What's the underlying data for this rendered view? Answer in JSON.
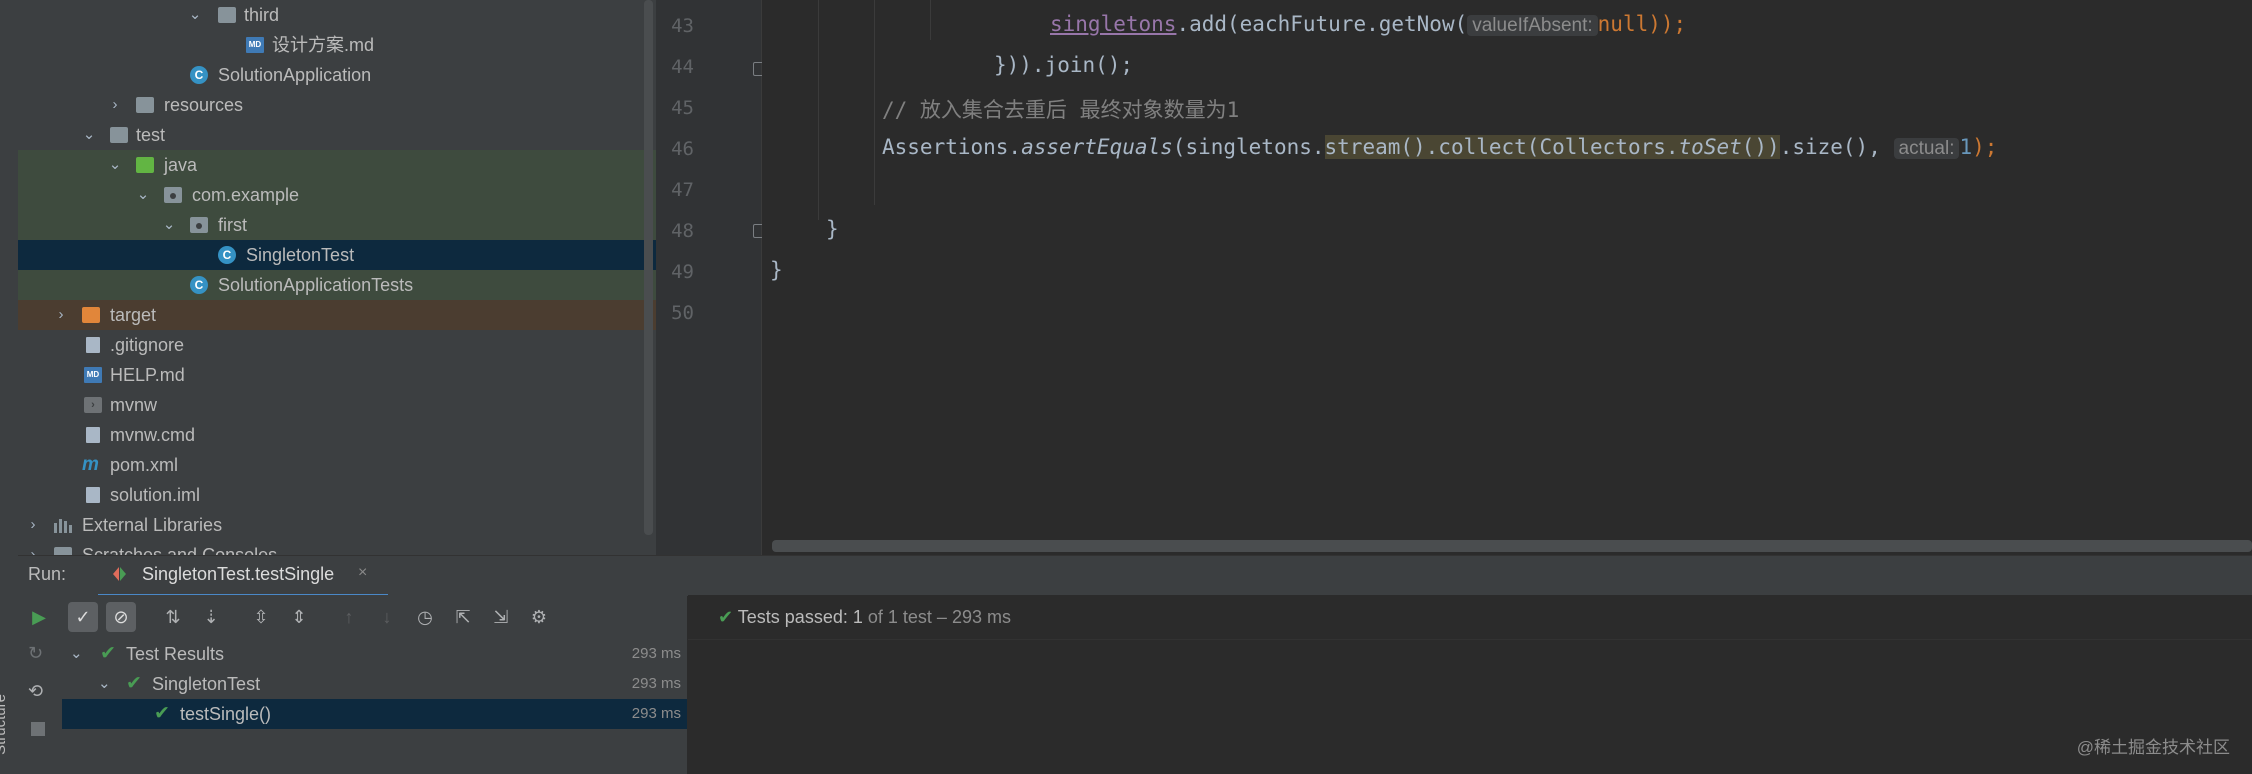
{
  "project_tree": {
    "items": [
      {
        "label": "third",
        "icon": "folder-icon"
      },
      {
        "label": "设计方案.md",
        "icon": "markdown-file-icon"
      },
      {
        "label": "SolutionApplication",
        "icon": "spring-class-icon"
      },
      {
        "label": "resources",
        "icon": "resources-folder-icon"
      },
      {
        "label": "test",
        "icon": "folder-icon"
      },
      {
        "label": "java",
        "icon": "test-source-folder-icon"
      },
      {
        "label": "com.example",
        "icon": "package-icon"
      },
      {
        "label": "first",
        "icon": "package-icon"
      },
      {
        "label": "SingletonTest",
        "icon": "test-class-icon"
      },
      {
        "label": "SolutionApplicationTests",
        "icon": "spring-class-icon"
      },
      {
        "label": "target",
        "icon": "excluded-folder-icon"
      },
      {
        "label": ".gitignore",
        "icon": "gitignore-file-icon"
      },
      {
        "label": "HELP.md",
        "icon": "markdown-file-icon"
      },
      {
        "label": "mvnw",
        "icon": "terminal-file-icon"
      },
      {
        "label": "mvnw.cmd",
        "icon": "text-file-icon"
      },
      {
        "label": "pom.xml",
        "icon": "maven-icon"
      },
      {
        "label": "solution.iml",
        "icon": "module-file-icon"
      },
      {
        "label": "External Libraries",
        "icon": "libraries-icon"
      },
      {
        "label": "Scratches and Consoles",
        "icon": "scratches-icon"
      }
    ]
  },
  "editor": {
    "line_numbers": [
      "43",
      "44",
      "45",
      "46",
      "47",
      "48",
      "49",
      "50"
    ],
    "line43": {
      "field": "singletons",
      "call": ".add(eachFuture.getNow(",
      "hint": "valueIfAbsent:",
      "kw": "null",
      "close": "));"
    },
    "line44": {
      "text": "})).join();"
    },
    "line45": {
      "comment": "// 放入集合去重后 最终对象数量为1"
    },
    "line46": {
      "cls": "Assertions.",
      "method": "assertEquals",
      "arg": "(singletons.",
      "hl": "stream().collect(Collectors.",
      "hl_method": "toSet",
      "hl_end": "())",
      "rest": ".size(),",
      "hint": "actual:",
      "num": "1",
      "close": ");"
    },
    "line48": {
      "text": "}"
    },
    "line49": {
      "text": "}"
    }
  },
  "run": {
    "label": "Run:",
    "tab_label": "SingletonTest.testSingle",
    "tab_close": "×",
    "toolbar": [
      {
        "name": "rerun-icon",
        "glyph": "▶"
      },
      {
        "name": "show-passed-icon",
        "glyph": "✓"
      },
      {
        "name": "show-ignored-icon",
        "glyph": "⊘"
      },
      {
        "name": "sort-alphabetically-icon",
        "glyph": "⇅"
      },
      {
        "name": "sort-by-duration-icon",
        "glyph": "⇣"
      },
      {
        "name": "expand-all-icon",
        "glyph": "⇳"
      },
      {
        "name": "collapse-all-icon",
        "glyph": "⇕"
      },
      {
        "name": "previous-failed-icon",
        "glyph": "↑"
      },
      {
        "name": "next-failed-icon",
        "glyph": "↓"
      },
      {
        "name": "test-history-icon",
        "glyph": "◷"
      },
      {
        "name": "import-tests-icon",
        "glyph": "⇱"
      },
      {
        "name": "export-tests-icon",
        "glyph": "⇲"
      },
      {
        "name": "settings-icon",
        "glyph": "⚙"
      }
    ],
    "status": {
      "check": "✔",
      "passed": "Tests passed:",
      "count": "1",
      "rest": "of 1 test – 293 ms"
    },
    "results": [
      {
        "name": "Test Results",
        "time": "293 ms"
      },
      {
        "name": "SingletonTest",
        "time": "293 ms"
      },
      {
        "name": "testSingle()",
        "time": "293 ms"
      }
    ]
  },
  "side": {
    "structure_tab": "Structure"
  },
  "watermark": "@稀土掘金技术社区",
  "colors": {
    "selection": "#0d293e",
    "test_highlight": "#3e4b3e",
    "excluded_highlight": "#4b3d30",
    "passed": "#499c54",
    "accent_tab": "#4a88c7"
  }
}
